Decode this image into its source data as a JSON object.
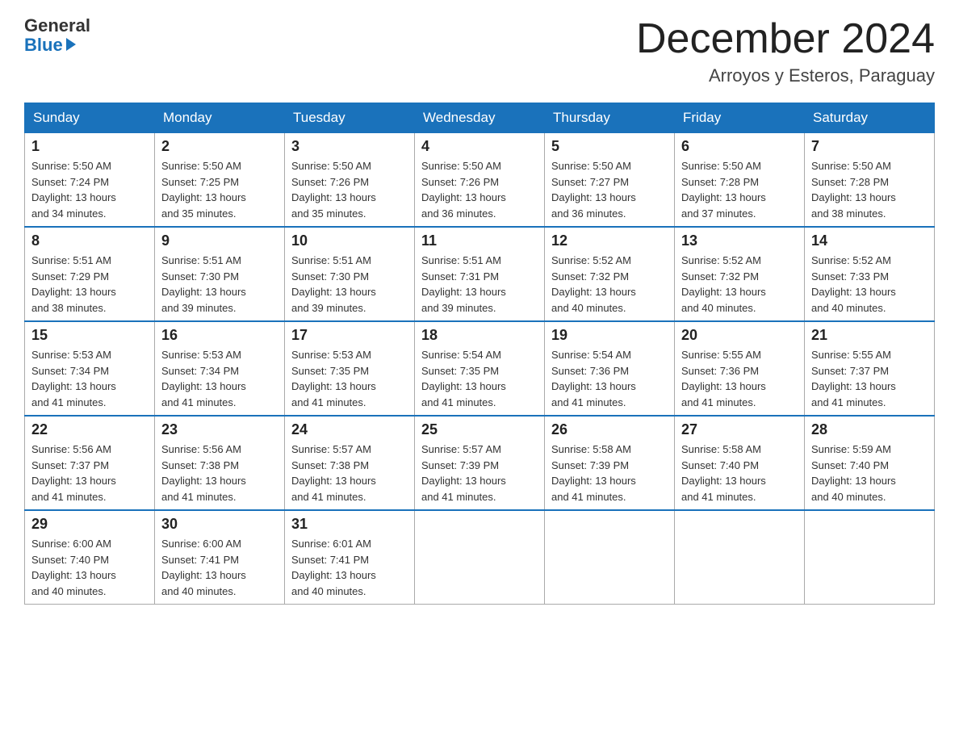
{
  "logo": {
    "general": "General",
    "blue": "Blue"
  },
  "title": "December 2024",
  "location": "Arroyos y Esteros, Paraguay",
  "days_of_week": [
    "Sunday",
    "Monday",
    "Tuesday",
    "Wednesday",
    "Thursday",
    "Friday",
    "Saturday"
  ],
  "weeks": [
    [
      {
        "day": "1",
        "sunrise": "5:50 AM",
        "sunset": "7:24 PM",
        "daylight": "13 hours and 34 minutes."
      },
      {
        "day": "2",
        "sunrise": "5:50 AM",
        "sunset": "7:25 PM",
        "daylight": "13 hours and 35 minutes."
      },
      {
        "day": "3",
        "sunrise": "5:50 AM",
        "sunset": "7:26 PM",
        "daylight": "13 hours and 35 minutes."
      },
      {
        "day": "4",
        "sunrise": "5:50 AM",
        "sunset": "7:26 PM",
        "daylight": "13 hours and 36 minutes."
      },
      {
        "day": "5",
        "sunrise": "5:50 AM",
        "sunset": "7:27 PM",
        "daylight": "13 hours and 36 minutes."
      },
      {
        "day": "6",
        "sunrise": "5:50 AM",
        "sunset": "7:28 PM",
        "daylight": "13 hours and 37 minutes."
      },
      {
        "day": "7",
        "sunrise": "5:50 AM",
        "sunset": "7:28 PM",
        "daylight": "13 hours and 38 minutes."
      }
    ],
    [
      {
        "day": "8",
        "sunrise": "5:51 AM",
        "sunset": "7:29 PM",
        "daylight": "13 hours and 38 minutes."
      },
      {
        "day": "9",
        "sunrise": "5:51 AM",
        "sunset": "7:30 PM",
        "daylight": "13 hours and 39 minutes."
      },
      {
        "day": "10",
        "sunrise": "5:51 AM",
        "sunset": "7:30 PM",
        "daylight": "13 hours and 39 minutes."
      },
      {
        "day": "11",
        "sunrise": "5:51 AM",
        "sunset": "7:31 PM",
        "daylight": "13 hours and 39 minutes."
      },
      {
        "day": "12",
        "sunrise": "5:52 AM",
        "sunset": "7:32 PM",
        "daylight": "13 hours and 40 minutes."
      },
      {
        "day": "13",
        "sunrise": "5:52 AM",
        "sunset": "7:32 PM",
        "daylight": "13 hours and 40 minutes."
      },
      {
        "day": "14",
        "sunrise": "5:52 AM",
        "sunset": "7:33 PM",
        "daylight": "13 hours and 40 minutes."
      }
    ],
    [
      {
        "day": "15",
        "sunrise": "5:53 AM",
        "sunset": "7:34 PM",
        "daylight": "13 hours and 41 minutes."
      },
      {
        "day": "16",
        "sunrise": "5:53 AM",
        "sunset": "7:34 PM",
        "daylight": "13 hours and 41 minutes."
      },
      {
        "day": "17",
        "sunrise": "5:53 AM",
        "sunset": "7:35 PM",
        "daylight": "13 hours and 41 minutes."
      },
      {
        "day": "18",
        "sunrise": "5:54 AM",
        "sunset": "7:35 PM",
        "daylight": "13 hours and 41 minutes."
      },
      {
        "day": "19",
        "sunrise": "5:54 AM",
        "sunset": "7:36 PM",
        "daylight": "13 hours and 41 minutes."
      },
      {
        "day": "20",
        "sunrise": "5:55 AM",
        "sunset": "7:36 PM",
        "daylight": "13 hours and 41 minutes."
      },
      {
        "day": "21",
        "sunrise": "5:55 AM",
        "sunset": "7:37 PM",
        "daylight": "13 hours and 41 minutes."
      }
    ],
    [
      {
        "day": "22",
        "sunrise": "5:56 AM",
        "sunset": "7:37 PM",
        "daylight": "13 hours and 41 minutes."
      },
      {
        "day": "23",
        "sunrise": "5:56 AM",
        "sunset": "7:38 PM",
        "daylight": "13 hours and 41 minutes."
      },
      {
        "day": "24",
        "sunrise": "5:57 AM",
        "sunset": "7:38 PM",
        "daylight": "13 hours and 41 minutes."
      },
      {
        "day": "25",
        "sunrise": "5:57 AM",
        "sunset": "7:39 PM",
        "daylight": "13 hours and 41 minutes."
      },
      {
        "day": "26",
        "sunrise": "5:58 AM",
        "sunset": "7:39 PM",
        "daylight": "13 hours and 41 minutes."
      },
      {
        "day": "27",
        "sunrise": "5:58 AM",
        "sunset": "7:40 PM",
        "daylight": "13 hours and 41 minutes."
      },
      {
        "day": "28",
        "sunrise": "5:59 AM",
        "sunset": "7:40 PM",
        "daylight": "13 hours and 40 minutes."
      }
    ],
    [
      {
        "day": "29",
        "sunrise": "6:00 AM",
        "sunset": "7:40 PM",
        "daylight": "13 hours and 40 minutes."
      },
      {
        "day": "30",
        "sunrise": "6:00 AM",
        "sunset": "7:41 PM",
        "daylight": "13 hours and 40 minutes."
      },
      {
        "day": "31",
        "sunrise": "6:01 AM",
        "sunset": "7:41 PM",
        "daylight": "13 hours and 40 minutes."
      },
      null,
      null,
      null,
      null
    ]
  ]
}
